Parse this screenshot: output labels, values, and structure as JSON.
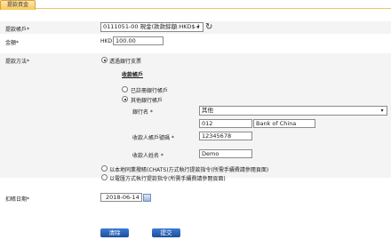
{
  "header": {
    "title": "提款資金"
  },
  "form": {
    "account_label": "提款帳戶*",
    "account_value": "0111051-00 現金(款款餘額:HKD$-)",
    "amount_label": "金額*",
    "amount_currency": "HKD",
    "amount_value": "100.00",
    "method_label": "提款方法*",
    "method_option_bank": "透過銀行支票",
    "receiving_account_heading": "收款帳戶",
    "registered_account_option": "已註冊銀行帳戶",
    "other_account_option": "其他銀行帳戶",
    "bank_name_label": "銀行名 *",
    "bank_name_select": "其他",
    "bank_code": "012",
    "bank_name_value": "Bank of China",
    "account_number_label": "收款人帳戶號碼 *",
    "account_number_value": "12345678",
    "recipient_name_label": "收款人姓名 *",
    "recipient_name_value": "Demo",
    "chats_option": "以本地同業撥賬(CHATS)方式執行提款指令(所需手續費請參閱頁面)",
    "telegraphic_option": "以電匯方式執行提款指令(所需手續費請參閱頁面)",
    "date_label": "扣賬日期*",
    "date_value": "2018-06-14"
  },
  "buttons": {
    "clear": "清除",
    "submit": "提交"
  }
}
